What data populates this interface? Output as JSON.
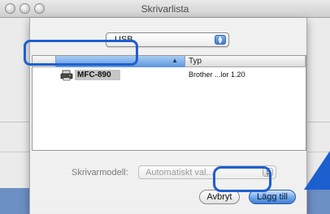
{
  "window": {
    "title": "Skrivarlista"
  },
  "connection_popup": {
    "value": "USB"
  },
  "list": {
    "columns": {
      "model": "",
      "type": "Typ"
    },
    "rows": [
      {
        "model": "MFC-890",
        "type": "Brother ...lor 1.20"
      }
    ]
  },
  "model_select": {
    "label": "Skrivarmodell:",
    "value": "Automatiskt val..."
  },
  "buttons": {
    "cancel": "Avbryt",
    "add": "Lägg till"
  },
  "colors": {
    "highlight": "#1f5fcf",
    "default_button": "#3f80d6"
  },
  "icons": {
    "printer": "printer-icon",
    "sort": "sort-ascending-icon",
    "arrow": "up-arrow-icon"
  }
}
